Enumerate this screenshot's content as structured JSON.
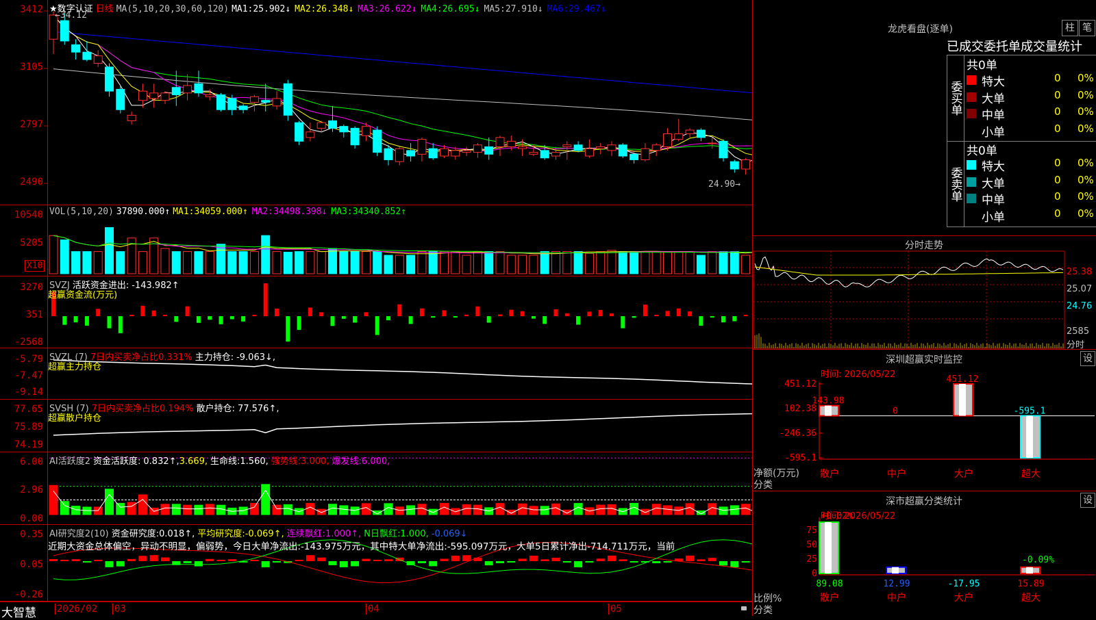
{
  "kline": {
    "star": "★",
    "cert": "数字认证",
    "period": "日线",
    "ma_label": "MA(5,10,20,30,60,120)",
    "ma": [
      {
        "label": "MA1:",
        "value": "25.902↓",
        "color": "#ffffff"
      },
      {
        "label": "MA2:",
        "value": "26.348↓",
        "color": "#ffff00"
      },
      {
        "label": "MA3:",
        "value": "26.622↓",
        "color": "#ff00ff"
      },
      {
        "label": "MA4:",
        "value": "26.695↓",
        "color": "#00ff00"
      },
      {
        "label": "MA5:",
        "value": "27.910↓",
        "color": "#c0c0c0"
      },
      {
        "label": "MA6:",
        "value": "29.467↓",
        "color": "#0000ff"
      }
    ],
    "ticks": [
      "3412",
      "3105",
      "2797",
      "2490"
    ],
    "high_mark": "34.12",
    "low_mark": "24.90"
  },
  "vol": {
    "title": "VOL(5,10,20)",
    "value": "37890.000↑",
    "ma": [
      {
        "label": "MA1:",
        "value": "34059.000↑",
        "color": "#ffff00"
      },
      {
        "label": "MA2:",
        "value": "34498.398↓",
        "color": "#ff00ff"
      },
      {
        "label": "MA3:",
        "value": "34340.852↑",
        "color": "#00ff00"
      }
    ],
    "ticks": [
      "10540",
      "5205"
    ],
    "unit": "X10"
  },
  "svzj": {
    "title": "SVZJ",
    "label": "活跃资金进出:",
    "value": "-143.982↑",
    "subtitle": "超赢资金流(万元)",
    "ticks": [
      "3270",
      "351",
      "-2568"
    ]
  },
  "svzl": {
    "title": "SVZL (7)",
    "ratio": "7日内买卖净占比0.331%",
    "label": "主力持仓:",
    "value": "-9.063↓,",
    "subtitle": "超赢主力持仓",
    "ticks": [
      "-5.79",
      "-7.47",
      "-9.14"
    ]
  },
  "svsh": {
    "title": "SVSH (7)",
    "ratio": "7日内买卖净占比0.194%",
    "label": "散户持仓:",
    "value": "77.576↑,",
    "subtitle": "超赢散户持仓",
    "ticks": [
      "77.65",
      "75.89",
      "74.19"
    ]
  },
  "ai1": {
    "title": "AI活跃度2",
    "label": "资金活跃度:",
    "v1": "0.832↑,",
    "v2": "3.669,",
    "life_label": "生命线:",
    "life": "1.560,",
    "strong_label": "强势线:",
    "strong": "3.000,",
    "burst_label": "爆发线:",
    "burst": "6.000,",
    "ticks": [
      "6.00",
      "2.96",
      "0.00"
    ]
  },
  "ai2": {
    "title": "AI研究度2(10)",
    "label": "资金研究度:",
    "value": "0.018↑,",
    "avg_label": "平均研究度:",
    "avg": "-0.069↑,",
    "red_label": "连续飘红:",
    "red": "1.000↑,",
    "nred_label": "N日飘红:",
    "nred": "1.000,",
    "last": "-0.069↓",
    "commentary": "近期大资金总体偏空，异动不明显，偏弱势，今日大单净流出:-143.975万元，其中特大单净流出:-595.097万元，大单5日累计净出-714.711万元，当前",
    "ticks": [
      "0.35",
      "0.05",
      "-0.26"
    ]
  },
  "footer": {
    "brand": "大智慧",
    "dates": [
      "2026/02",
      "03",
      "04",
      "05"
    ]
  },
  "dragon": {
    "title": "龙虎看盘(逐单)",
    "btn1": "柱",
    "btn2": "笔",
    "header": "已成交委托单成交量统计",
    "buy": {
      "side": "委买单",
      "total": "共0单",
      "rows": [
        {
          "name": "特大",
          "count": "0",
          "pct": "0%",
          "color": "#ff0000"
        },
        {
          "name": "大单",
          "count": "0",
          "pct": "0%",
          "color": "#a00000"
        },
        {
          "name": "中单",
          "count": "0",
          "pct": "0%",
          "color": "#800000"
        },
        {
          "name": "小单",
          "count": "0",
          "pct": "0%",
          "color": "#000000"
        }
      ]
    },
    "sell": {
      "side": "委卖单",
      "total": "共0单",
      "rows": [
        {
          "name": "特大",
          "count": "0",
          "pct": "0%",
          "color": "#00ffff"
        },
        {
          "name": "大单",
          "count": "0",
          "pct": "0%",
          "color": "#00a0a0"
        },
        {
          "name": "中单",
          "count": "0",
          "pct": "0%",
          "color": "#008080"
        },
        {
          "name": "小单",
          "count": "0",
          "pct": "0%",
          "color": "#000000"
        }
      ]
    }
  },
  "intraday": {
    "title": "分时走势",
    "prices": [
      "25.38",
      "25.07",
      "24.76"
    ],
    "vol": "2585",
    "vol_label": "分时"
  },
  "monitor": {
    "title": "深圳超赢实时监控",
    "btn": "设",
    "time": "时间: 2026/05/22",
    "ticks": [
      "451.12",
      "102.38",
      "-246.36",
      "-595.1"
    ],
    "ylabel": "净额(万元)",
    "xlabel": "分类",
    "bars": [
      {
        "name": "散户",
        "value": 143.98,
        "label": "143.98",
        "color": "#ff0000"
      },
      {
        "name": "中户",
        "value": 0,
        "label": "0",
        "color": "#ff0000"
      },
      {
        "name": "大户",
        "value": 451.12,
        "label": "451.12",
        "color": "#ff0000"
      },
      {
        "name": "超大",
        "value": -595.1,
        "label": "-595.1",
        "color": "#00ffff"
      }
    ]
  },
  "classify": {
    "title": "深市超赢分类统计",
    "btn": "设",
    "time": "时间: 2026/05/22",
    "ticks": [
      "75",
      "50",
      "25",
      "0"
    ],
    "ylabel": "比例%",
    "xlabel": "分类",
    "top_labels": [
      {
        "text": "+0.02%",
        "color": "#ff0000"
      },
      {
        "text": "-0.09%",
        "color": "#00ff00"
      }
    ],
    "bars": [
      {
        "name": "散户",
        "value": 89.08,
        "label": "89.08",
        "color": "#00ff00",
        "lcolor": "#00ff00",
        "ncolor": "#ff0000"
      },
      {
        "name": "中户",
        "value": 12.99,
        "label": "12.99",
        "color": "#0000ff",
        "lcolor": "#2060ff",
        "ncolor": "#ff0000"
      },
      {
        "name": "大户",
        "value": -17.95,
        "label": "-17.95",
        "color": "#00ffff",
        "lcolor": "#00ffff",
        "ncolor": "#ff0000"
      },
      {
        "name": "超大",
        "value": 15.89,
        "label": "15.89",
        "color": "#ff0000",
        "lcolor": "#ff0000",
        "ncolor": "#ff0000"
      }
    ]
  },
  "chart_data": {
    "type": "candlestick",
    "title": "数字认证 日线",
    "ylim": [
      24.9,
      34.12
    ],
    "candles": [
      [
        32.6,
        33.9,
        31.8,
        34.1
      ],
      [
        33.6,
        32.5,
        32.3,
        34.0
      ],
      [
        32.3,
        31.9,
        31.5,
        32.6
      ],
      [
        31.9,
        31.5,
        31.4,
        32.5
      ],
      [
        31.3,
        31.7,
        31.1,
        32.0
      ],
      [
        31.1,
        29.8,
        29.5,
        31.3
      ],
      [
        29.9,
        28.8,
        28.6,
        30.1
      ],
      [
        28.2,
        28.5,
        28.0,
        28.7
      ],
      [
        29.3,
        29.8,
        28.9,
        30.2
      ],
      [
        29.4,
        29.7,
        28.9,
        30.2
      ],
      [
        29.3,
        29.7,
        29.1,
        29.8
      ],
      [
        30.0,
        29.6,
        29.0,
        30.9
      ],
      [
        29.7,
        30.1,
        29.3,
        30.7
      ],
      [
        30.2,
        29.7,
        29.5,
        30.9
      ],
      [
        29.5,
        29.6,
        29.3,
        29.9
      ],
      [
        29.6,
        28.8,
        28.7,
        29.7
      ],
      [
        29.4,
        28.8,
        28.5,
        29.6
      ],
      [
        29.0,
        28.8,
        28.6,
        29.1
      ],
      [
        29.2,
        29.5,
        28.7,
        29.6
      ],
      [
        29.3,
        29.2,
        28.7,
        30.2
      ],
      [
        29.0,
        29.4,
        28.8,
        29.8
      ],
      [
        30.2,
        28.5,
        28.2,
        30.4
      ],
      [
        28.1,
        27.1,
        26.9,
        28.2
      ],
      [
        27.3,
        27.6,
        27.1,
        28.1
      ],
      [
        27.8,
        28.1,
        27.6,
        28.2
      ],
      [
        28.2,
        27.8,
        27.6,
        29.0
      ],
      [
        27.9,
        27.6,
        27.3,
        28.0
      ],
      [
        27.8,
        26.9,
        26.7,
        27.9
      ],
      [
        27.4,
        27.9,
        27.1,
        28.1
      ],
      [
        27.7,
        26.5,
        26.3,
        27.9
      ],
      [
        26.7,
        26.1,
        25.8,
        26.9
      ],
      [
        26.0,
        26.7,
        25.8,
        26.8
      ],
      [
        26.6,
        26.3,
        26.0,
        27.0
      ],
      [
        26.4,
        27.2,
        26.0,
        27.3
      ],
      [
        26.7,
        26.2,
        26.1,
        27.0
      ],
      [
        26.3,
        26.7,
        26.2,
        26.9
      ],
      [
        26.3,
        26.6,
        26.1,
        26.8
      ],
      [
        26.5,
        26.6,
        26.3,
        26.8
      ],
      [
        26.5,
        26.9,
        26.2,
        27.0
      ],
      [
        26.8,
        26.4,
        26.1,
        27.3
      ],
      [
        26.8,
        27.3,
        26.3,
        27.4
      ],
      [
        26.8,
        27.1,
        26.6,
        27.4
      ],
      [
        26.7,
        26.8,
        26.3,
        27.2
      ],
      [
        26.4,
        26.5,
        26.3,
        26.9
      ],
      [
        26.6,
        26.2,
        26.1,
        26.9
      ],
      [
        26.3,
        26.5,
        26.1,
        26.8
      ],
      [
        26.8,
        26.9,
        26.1,
        27.1
      ],
      [
        26.9,
        26.6,
        26.5,
        27.1
      ],
      [
        26.3,
        26.7,
        26.2,
        27.2
      ],
      [
        26.7,
        26.8,
        26.4,
        27.0
      ],
      [
        26.6,
        26.9,
        26.3,
        27.1
      ],
      [
        26.9,
        26.3,
        26.2,
        27.0
      ],
      [
        26.4,
        26.1,
        25.9,
        26.5
      ],
      [
        26.1,
        26.7,
        26.0,
        27.0
      ],
      [
        26.6,
        26.9,
        26.3,
        27.0
      ],
      [
        26.8,
        27.5,
        26.6,
        27.8
      ],
      [
        27.2,
        27.5,
        27.1,
        28.3
      ],
      [
        27.5,
        27.7,
        27.3,
        27.8
      ],
      [
        27.7,
        27.3,
        27.1,
        27.8
      ],
      [
        27.0,
        27.0,
        26.7,
        27.3
      ],
      [
        27.1,
        26.2,
        26.0,
        27.2
      ],
      [
        26.0,
        25.6,
        25.4,
        26.1
      ],
      [
        25.6,
        26.1,
        25.3,
        26.2
      ],
      [
        26.3,
        26.7,
        26.0,
        26.9
      ],
      [
        26.6,
        26.4,
        25.9,
        26.7
      ],
      [
        26.8,
        26.2,
        26.0,
        26.9
      ],
      [
        26.3,
        25.3,
        25.1,
        26.4
      ],
      [
        25.4,
        25.1,
        24.9,
        25.6
      ]
    ],
    "volume": [
      62,
      55,
      36,
      36,
      36,
      75,
      36,
      58,
      36,
      58,
      41,
      36,
      36,
      36,
      36,
      48,
      36,
      36,
      36,
      62,
      36,
      35,
      36,
      36,
      36,
      41,
      36,
      36,
      36,
      36,
      30,
      30,
      30,
      36,
      36,
      36,
      36,
      30,
      36,
      36,
      36,
      30,
      30,
      30,
      36,
      36,
      36,
      36,
      33,
      36,
      38,
      36,
      36,
      36,
      36,
      36,
      36,
      36,
      30,
      36,
      36,
      36,
      30,
      36,
      36,
      30,
      36,
      36
    ]
  }
}
